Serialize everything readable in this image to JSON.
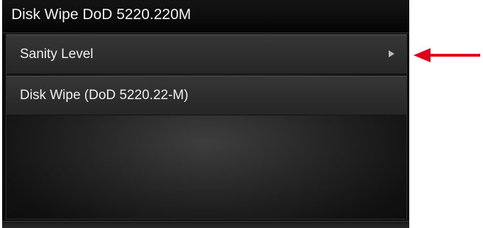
{
  "header": {
    "title": "Disk Wipe DoD 5220.220M"
  },
  "menu": {
    "items": [
      {
        "label": "Sanity Level",
        "icon": "chevron-right-icon",
        "has_submenu": true
      },
      {
        "label": "Disk Wipe (DoD 5220.22-M)",
        "has_submenu": false
      }
    ]
  },
  "annotation": {
    "icon": "red-arrow-left-icon",
    "color": "#e0001b"
  },
  "colors": {
    "background": "#0b0b0b",
    "menu_item": "#303030",
    "text": "#efefef"
  }
}
